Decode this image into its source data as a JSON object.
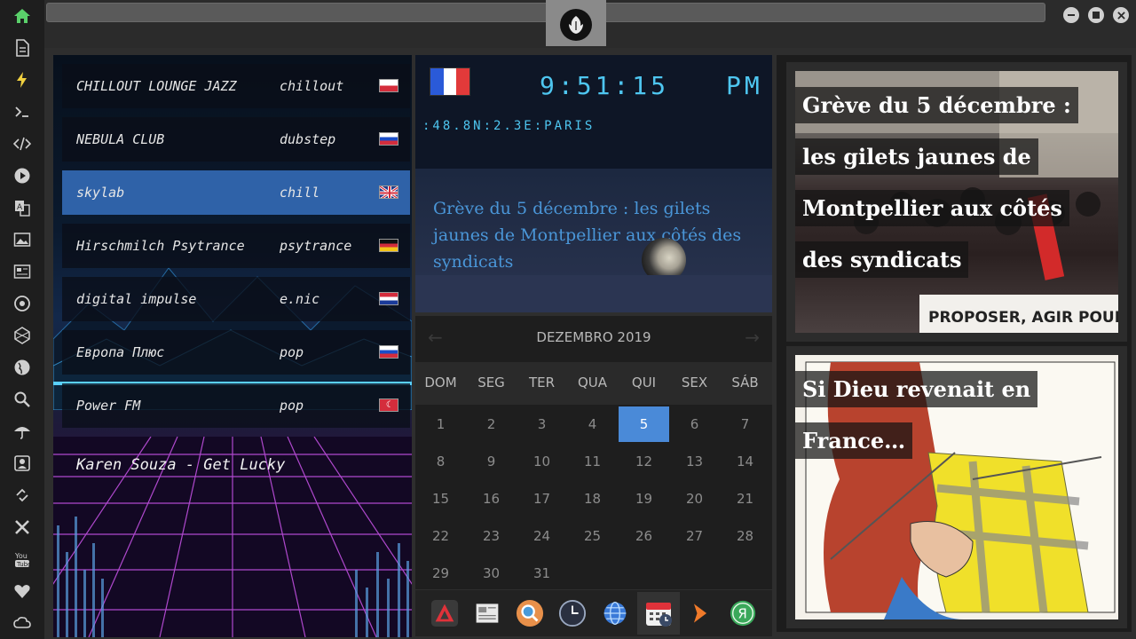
{
  "window": {
    "controls": [
      "minimize",
      "maximize",
      "close"
    ]
  },
  "rail": {
    "icons": [
      "home-icon",
      "document-icon",
      "bolt-icon",
      "terminal-icon",
      "code-icon",
      "play-icon",
      "translate-icon",
      "image-icon",
      "newspaper-icon",
      "settings-icon",
      "network-icon",
      "globe-icon",
      "search-icon",
      "umbrella-icon",
      "contact-icon",
      "link-icon",
      "tools-icon",
      "youtube-icon",
      "heart-icon",
      "cloud-icon"
    ]
  },
  "radio": {
    "stations": [
      {
        "name": "CHILLOUT LOUNGE JAZZ",
        "genre": "chillout",
        "flag": "pl"
      },
      {
        "name": "NEBULA CLUB",
        "genre": "dubstep",
        "flag": "ru"
      },
      {
        "name": "skylab",
        "genre": "chill",
        "flag": "gb"
      },
      {
        "name": "Hirschmilch Psytrance",
        "genre": "psytrance",
        "flag": "de"
      },
      {
        "name": "digital impulse",
        "genre": "e.nic",
        "flag": "hr"
      },
      {
        "name": "Европа Плюс",
        "genre": "pop",
        "flag": "ru"
      },
      {
        "name": "Power FM",
        "genre": "pop",
        "flag": "tr"
      }
    ],
    "active_index": 2,
    "now_playing": "Karen Souza - Get Lucky"
  },
  "clock": {
    "time": "9:51:15",
    "ampm": "PM",
    "location": ":48.8N:2.3E:PARIS",
    "headline": "Grève du 5 décembre : les gilets jaunes de Montpellier aux côtés des syndicats"
  },
  "calendar": {
    "month_label": "DEZEMBRO 2019",
    "weekdays": [
      "DOM",
      "SEG",
      "TER",
      "QUA",
      "QUI",
      "SEX",
      "SÁB"
    ],
    "days": [
      1,
      2,
      3,
      4,
      5,
      6,
      7,
      8,
      9,
      10,
      11,
      12,
      13,
      14,
      15,
      16,
      17,
      18,
      19,
      20,
      21,
      22,
      23,
      24,
      25,
      26,
      27,
      28,
      29,
      30,
      31
    ],
    "today": 5
  },
  "dock": {
    "apps": [
      "app-launcher-icon",
      "news-icon",
      "search-icon",
      "clock-icon",
      "globe-icon",
      "calendar-icon",
      "arrow-icon",
      "yandex-icon"
    ],
    "active_index": 5
  },
  "news": [
    {
      "lines": [
        "Grève du 5 décembre :",
        "les gilets jaunes de",
        "Montpellier aux côtés",
        "des syndicats"
      ]
    },
    {
      "lines": [
        "Si Dieu revenait en",
        "France…"
      ]
    }
  ],
  "colors": {
    "accent_blue": "#4ec6f0",
    "calendar_today": "#4a8ad8",
    "active_station": "#2f62a8"
  }
}
